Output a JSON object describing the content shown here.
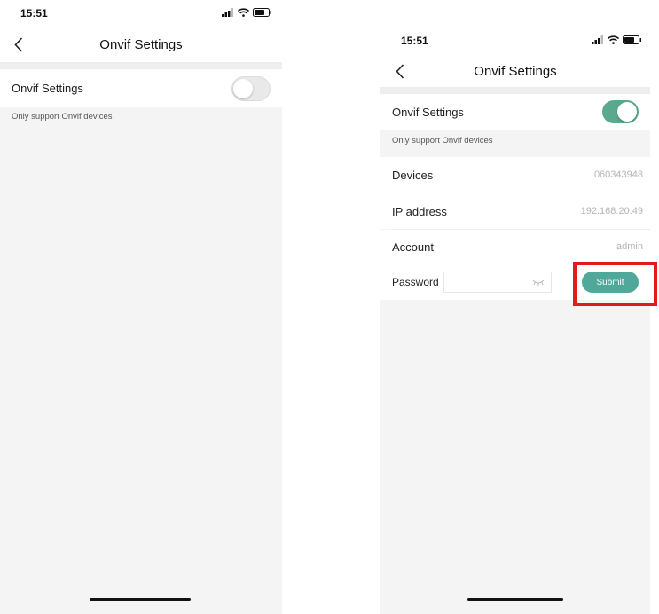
{
  "status_bar": {
    "time": "15:51"
  },
  "nav": {
    "title": "Onvif Settings"
  },
  "left_screen": {
    "onvif_label": "Onvif Settings",
    "onvif_enabled": false,
    "note": "Only support Onvif devices"
  },
  "right_screen": {
    "onvif_label": "Onvif Settings",
    "onvif_enabled": true,
    "note": "Only support Onvif devices",
    "devices": {
      "label": "Devices",
      "value": "060343948"
    },
    "ip": {
      "label": "IP address",
      "value": "192.168.20.49"
    },
    "account": {
      "label": "Account",
      "value": "admin"
    },
    "password": {
      "label": "Password",
      "value": ""
    },
    "submit_label": "Submit"
  },
  "colors": {
    "accent": "#5aa98f",
    "submit": "#4fa89a",
    "highlight": "#e11b1b",
    "background": "#f4f4f4"
  },
  "icons": [
    "back-chevron-icon",
    "signal-icon",
    "wifi-icon",
    "battery-icon",
    "eye-hidden-icon"
  ]
}
